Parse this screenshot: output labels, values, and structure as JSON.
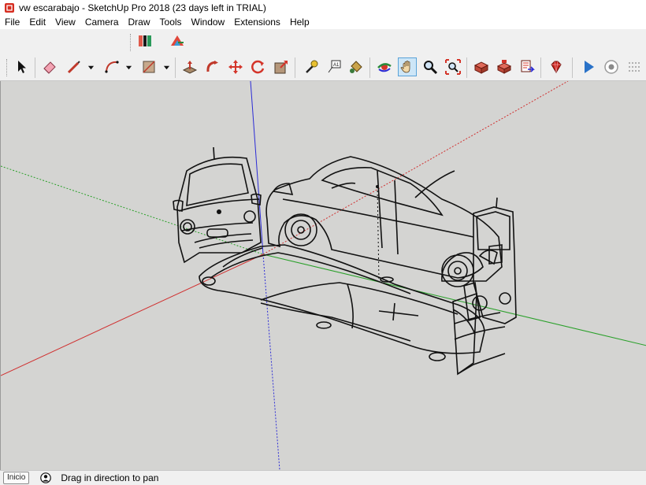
{
  "window": {
    "title": "vw escarabajo - SketchUp Pro 2018 (23 days left in TRIAL)"
  },
  "menu": [
    "File",
    "Edit",
    "View",
    "Camera",
    "Draw",
    "Tools",
    "Window",
    "Extensions",
    "Help"
  ],
  "status": {
    "button_label": "Inicio",
    "hint": "Drag in direction to pan"
  },
  "colors": {
    "axis_red": "#d03030",
    "axis_green": "#2aa02a",
    "axis_blue": "#2b2bd6",
    "viewport_bg": "#d4d4d2",
    "active_tool": "#cde6f7"
  },
  "toolbar": {
    "top": [
      "warehouse-extension-icon",
      "layout-send-icon"
    ],
    "main": [
      "select-icon",
      "eraser-icon",
      "line-icon",
      "arc-icon",
      "rectangle-icon",
      "push-pull-icon",
      "follow-me-icon",
      "move-icon",
      "rotate-icon",
      "scale-icon",
      "tape-measure-icon",
      "text-icon",
      "paint-bucket-icon",
      "orbit-icon",
      "pan-icon",
      "zoom-icon",
      "zoom-extents-icon",
      "3d-warehouse-icon",
      "extension-warehouse-icon",
      "send-to-layout-icon",
      "ruby-console-icon",
      "play-icon",
      "record-icon",
      "dots-icon"
    ],
    "active": "pan-icon"
  }
}
